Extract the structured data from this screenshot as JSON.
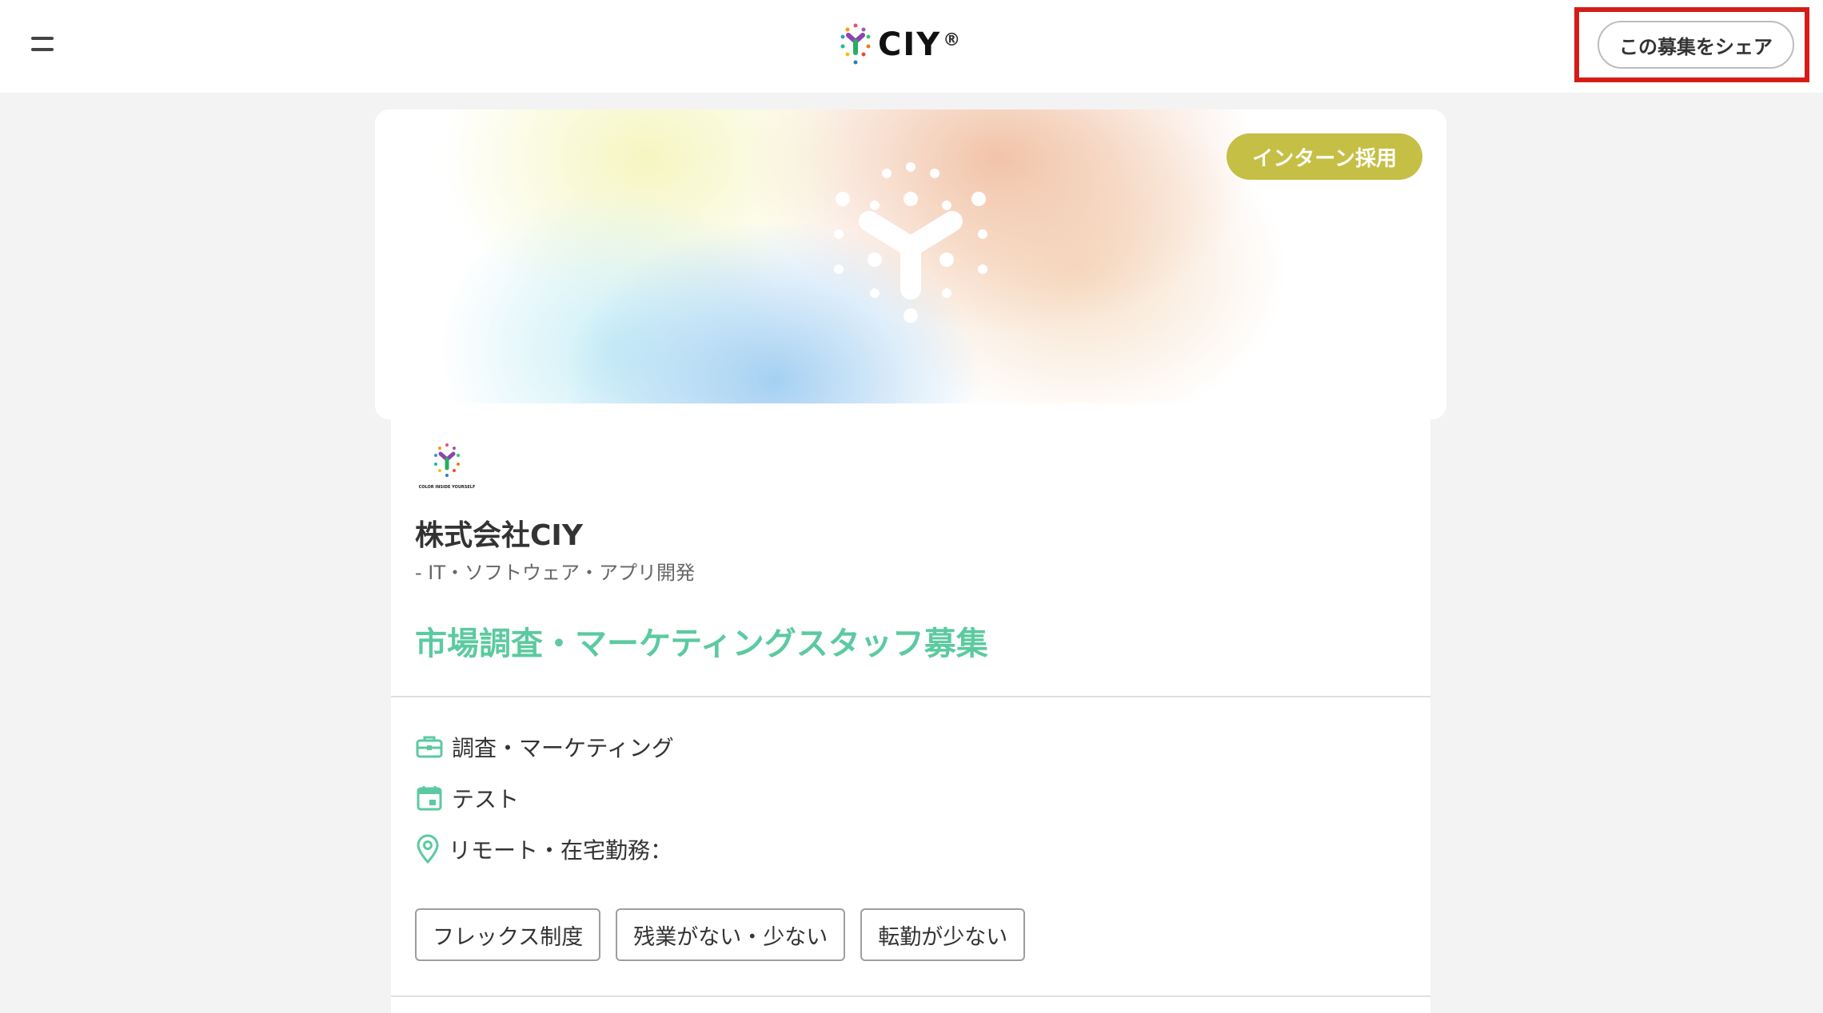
{
  "header": {
    "brand": "CIY",
    "brand_reg": "®",
    "share_label": "この募集をシェア"
  },
  "hero": {
    "badge": "インターン採用"
  },
  "company": {
    "logo_caption": "COLOR INSIDE YOURSELF",
    "name": "株式会社CIY",
    "industry": "- IT・ソフトウェア・アプリ開発"
  },
  "job": {
    "title": "市場調査・マーケティングスタッフ募集",
    "category": "調査・マーケティング",
    "schedule": "テスト",
    "location": "リモート・在宅勤務："
  },
  "tags": [
    "フレックス制度",
    "残業がない・少ない",
    "転勤が少ない"
  ],
  "colors": {
    "accent_green": "#5ccaa0",
    "badge_olive": "#c5bf45",
    "highlight_red": "#d41d17"
  },
  "icons": {
    "menu": "hamburger-icon",
    "category": "briefcase-icon",
    "schedule": "calendar-icon",
    "location": "map-pin-icon"
  }
}
